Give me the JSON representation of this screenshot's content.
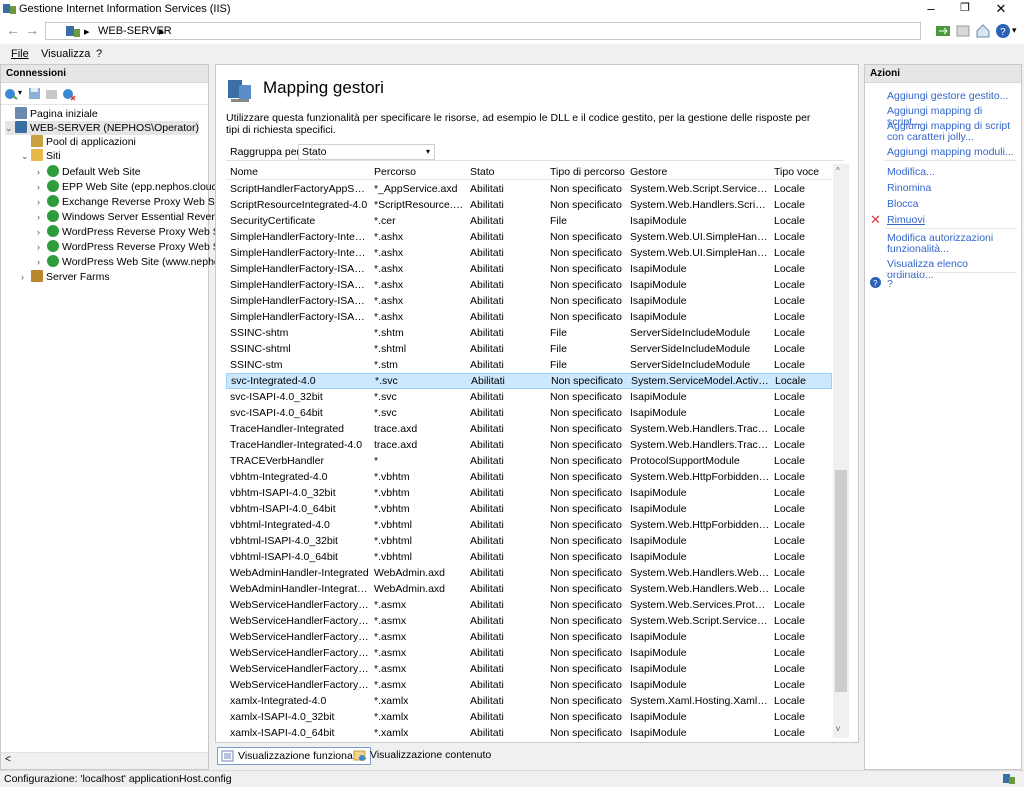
{
  "window": {
    "title": "Gestione Internet Information Services (IIS)",
    "minimize": "–",
    "maximize": "❐",
    "close": "✕"
  },
  "address": {
    "back": "←",
    "forward": "→",
    "crumb_sep": "▸",
    "crumb": "WEB-SERVER",
    "crumb_end": "▸"
  },
  "menu": {
    "file": "File",
    "view": "Visualizza",
    "help": "?"
  },
  "connections": {
    "header": "Connessioni",
    "tree": [
      {
        "label": "Pagina iniziale",
        "level": 1,
        "exp": "",
        "icon": "home"
      },
      {
        "label": "WEB-SERVER (NEPHOS\\Operator)",
        "level": 0,
        "exp": "⌄",
        "icon": "server",
        "selected": true
      },
      {
        "label": "Pool di applicazioni",
        "level": 1,
        "exp": "",
        "icon": "pool"
      },
      {
        "label": "Siti",
        "level": 1,
        "exp": "⌄",
        "icon": "folder"
      },
      {
        "label": "Default Web Site",
        "level": 2,
        "exp": "›",
        "icon": "globe"
      },
      {
        "label": "EPP Web Site (epp.nephos.cloud)",
        "level": 2,
        "exp": "›",
        "icon": "globe"
      },
      {
        "label": "Exchange Reverse Proxy Web Site",
        "level": 2,
        "exp": "›",
        "icon": "globe"
      },
      {
        "label": "Windows Server Essential Reverse",
        "level": 2,
        "exp": "›",
        "icon": "globe"
      },
      {
        "label": "WordPress Reverse Proxy Web Site",
        "level": 2,
        "exp": "›",
        "icon": "globe"
      },
      {
        "label": "WordPress Reverse Proxy Web Site",
        "level": 2,
        "exp": "›",
        "icon": "globe"
      },
      {
        "label": "WordPress Web Site (www.nephos",
        "level": 2,
        "exp": "›",
        "icon": "globe"
      },
      {
        "label": "Server Farms",
        "level": 1,
        "exp": "›",
        "icon": "farm"
      }
    ],
    "scroll_left": "<"
  },
  "main": {
    "title": "Mapping gestori",
    "description": "Utilizzare questa funzionalità per specificare le risorse, ad esempio le DLL e il codice gestito, per la gestione delle risposte per tipi di richiesta specifici.",
    "group_label": "Raggruppa per:",
    "group_value": "Stato",
    "group_arrow": "▾",
    "columns": [
      "Nome",
      "Percorso",
      "Stato",
      "Tipo di percorso",
      "Gestore",
      "Tipo voce"
    ],
    "rows": [
      [
        "ScriptHandlerFactoryAppServi...",
        "*_AppService.axd",
        "Abilitati",
        "Non specificato",
        "System.Web.Script.Services.S...",
        "Locale"
      ],
      [
        "ScriptResourceIntegrated-4.0",
        "*ScriptResource.axd",
        "Abilitati",
        "Non specificato",
        "System.Web.Handlers.ScriptR...",
        "Locale"
      ],
      [
        "SecurityCertificate",
        "*.cer",
        "Abilitati",
        "File",
        "IsapiModule",
        "Locale"
      ],
      [
        "SimpleHandlerFactory-Integra...",
        "*.ashx",
        "Abilitati",
        "Non specificato",
        "System.Web.UI.SimpleHandle...",
        "Locale"
      ],
      [
        "SimpleHandlerFactory-Integra...",
        "*.ashx",
        "Abilitati",
        "Non specificato",
        "System.Web.UI.SimpleHandle...",
        "Locale"
      ],
      [
        "SimpleHandlerFactory-ISAPI-2.0",
        "*.ashx",
        "Abilitati",
        "Non specificato",
        "IsapiModule",
        "Locale"
      ],
      [
        "SimpleHandlerFactory-ISAPI-2...",
        "*.ashx",
        "Abilitati",
        "Non specificato",
        "IsapiModule",
        "Locale"
      ],
      [
        "SimpleHandlerFactory-ISAPI-4...",
        "*.ashx",
        "Abilitati",
        "Non specificato",
        "IsapiModule",
        "Locale"
      ],
      [
        "SimpleHandlerFactory-ISAPI-4...",
        "*.ashx",
        "Abilitati",
        "Non specificato",
        "IsapiModule",
        "Locale"
      ],
      [
        "SSINC-shtm",
        "*.shtm",
        "Abilitati",
        "File",
        "ServerSideIncludeModule",
        "Locale"
      ],
      [
        "SSINC-shtml",
        "*.shtml",
        "Abilitati",
        "File",
        "ServerSideIncludeModule",
        "Locale"
      ],
      [
        "SSINC-stm",
        "*.stm",
        "Abilitati",
        "File",
        "ServerSideIncludeModule",
        "Locale"
      ],
      [
        "svc-Integrated-4.0",
        "*.svc",
        "Abilitati",
        "Non specificato",
        "System.ServiceModel.Activati...",
        "Locale"
      ],
      [
        "svc-ISAPI-4.0_32bit",
        "*.svc",
        "Abilitati",
        "Non specificato",
        "IsapiModule",
        "Locale"
      ],
      [
        "svc-ISAPI-4.0_64bit",
        "*.svc",
        "Abilitati",
        "Non specificato",
        "IsapiModule",
        "Locale"
      ],
      [
        "TraceHandler-Integrated",
        "trace.axd",
        "Abilitati",
        "Non specificato",
        "System.Web.Handlers.TraceH...",
        "Locale"
      ],
      [
        "TraceHandler-Integrated-4.0",
        "trace.axd",
        "Abilitati",
        "Non specificato",
        "System.Web.Handlers.TraceH...",
        "Locale"
      ],
      [
        "TRACEVerbHandler",
        "*",
        "Abilitati",
        "Non specificato",
        "ProtocolSupportModule",
        "Locale"
      ],
      [
        "vbhtm-Integrated-4.0",
        "*.vbhtm",
        "Abilitati",
        "Non specificato",
        "System.Web.HttpForbiddenH...",
        "Locale"
      ],
      [
        "vbhtm-ISAPI-4.0_32bit",
        "*.vbhtm",
        "Abilitati",
        "Non specificato",
        "IsapiModule",
        "Locale"
      ],
      [
        "vbhtm-ISAPI-4.0_64bit",
        "*.vbhtm",
        "Abilitati",
        "Non specificato",
        "IsapiModule",
        "Locale"
      ],
      [
        "vbhtml-Integrated-4.0",
        "*.vbhtml",
        "Abilitati",
        "Non specificato",
        "System.Web.HttpForbiddenH...",
        "Locale"
      ],
      [
        "vbhtml-ISAPI-4.0_32bit",
        "*.vbhtml",
        "Abilitati",
        "Non specificato",
        "IsapiModule",
        "Locale"
      ],
      [
        "vbhtml-ISAPI-4.0_64bit",
        "*.vbhtml",
        "Abilitati",
        "Non specificato",
        "IsapiModule",
        "Locale"
      ],
      [
        "WebAdminHandler-Integrated",
        "WebAdmin.axd",
        "Abilitati",
        "Non specificato",
        "System.Web.Handlers.WebAd...",
        "Locale"
      ],
      [
        "WebAdminHandler-Integrated...",
        "WebAdmin.axd",
        "Abilitati",
        "Non specificato",
        "System.Web.Handlers.WebAd...",
        "Locale"
      ],
      [
        "WebServiceHandlerFactory-Int...",
        "*.asmx",
        "Abilitati",
        "Non specificato",
        "System.Web.Services.Protoco...",
        "Locale"
      ],
      [
        "WebServiceHandlerFactory-Int...",
        "*.asmx",
        "Abilitati",
        "Non specificato",
        "System.Web.Script.Services.S...",
        "Locale"
      ],
      [
        "WebServiceHandlerFactory-IS...",
        "*.asmx",
        "Abilitati",
        "Non specificato",
        "IsapiModule",
        "Locale"
      ],
      [
        "WebServiceHandlerFactory-IS...",
        "*.asmx",
        "Abilitati",
        "Non specificato",
        "IsapiModule",
        "Locale"
      ],
      [
        "WebServiceHandlerFactory-IS...",
        "*.asmx",
        "Abilitati",
        "Non specificato",
        "IsapiModule",
        "Locale"
      ],
      [
        "WebServiceHandlerFactory-IS...",
        "*.asmx",
        "Abilitati",
        "Non specificato",
        "IsapiModule",
        "Locale"
      ],
      [
        "xamlx-Integrated-4.0",
        "*.xamlx",
        "Abilitati",
        "Non specificato",
        "System.Xaml.Hosting.XamlHt...",
        "Locale"
      ],
      [
        "xamlx-ISAPI-4.0_32bit",
        "*.xamlx",
        "Abilitati",
        "Non specificato",
        "IsapiModule",
        "Locale"
      ],
      [
        "xamlx-ISAPI-4.0_64bit",
        "*.xamlx",
        "Abilitati",
        "Non specificato",
        "IsapiModule",
        "Locale"
      ]
    ],
    "selected_row": 12,
    "scroll_up": "^",
    "scroll_down": "v"
  },
  "view_tabs": {
    "features": "Visualizzazione funzionalità",
    "content": "Visualizzazione contenuto"
  },
  "actions": {
    "header": "Azioni",
    "items": [
      "Aggiungi gestore gestito...",
      "Aggiungi mapping di script...",
      "Aggiungi mapping di script con caratteri jolly...",
      "Aggiungi mapping moduli...",
      "Modifica...",
      "Rinomina",
      "Blocca",
      "Rimuovi",
      "Modifica autorizzazioni funzionalità...",
      "Visualizza elenco ordinato...",
      "?"
    ]
  },
  "status": {
    "text": "Configurazione: 'localhost' applicationHost.config"
  },
  "colors": {
    "accent": "#3366cc",
    "selection": "#cce8ff",
    "remove_red": "#d83b3b"
  }
}
